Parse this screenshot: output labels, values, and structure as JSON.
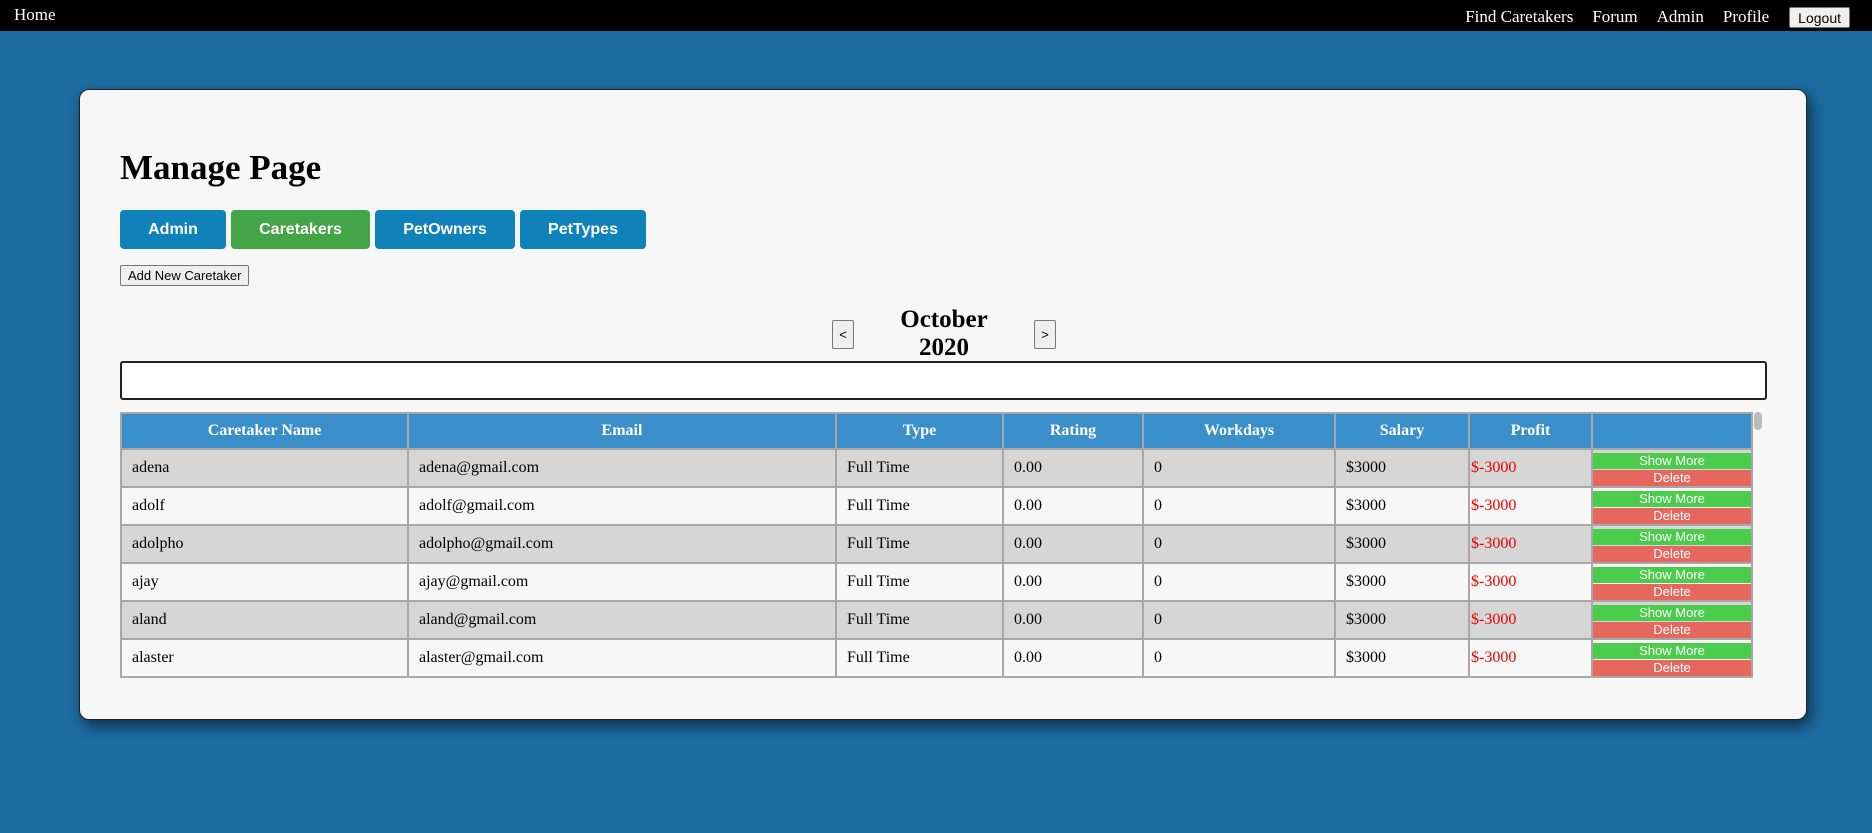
{
  "nav": {
    "home": "Home",
    "links": [
      "Find Caretakers",
      "Forum",
      "Admin",
      "Profile"
    ],
    "logout": "Logout"
  },
  "page": {
    "title": "Manage Page",
    "tabs": [
      "Admin",
      "Caretakers",
      "PetOwners",
      "PetTypes"
    ],
    "active_tab": "Caretakers",
    "add_button": "Add New Caretaker",
    "prev": "<",
    "next": ">",
    "month": "October 2020",
    "search_value": ""
  },
  "table": {
    "headers": [
      "Caretaker Name",
      "Email",
      "Type",
      "Rating",
      "Workdays",
      "Salary",
      "Profit",
      ""
    ],
    "show_more": "Show More",
    "delete": "Delete",
    "rows": [
      [
        "adena",
        "adena@gmail.com",
        "Full Time",
        "0.00",
        "0",
        "$3000",
        "$-3000"
      ],
      [
        "adolf",
        "adolf@gmail.com",
        "Full Time",
        "0.00",
        "0",
        "$3000",
        "$-3000"
      ],
      [
        "adolpho",
        "adolpho@gmail.com",
        "Full Time",
        "0.00",
        "0",
        "$3000",
        "$-3000"
      ],
      [
        "ajay",
        "ajay@gmail.com",
        "Full Time",
        "0.00",
        "0",
        "$3000",
        "$-3000"
      ],
      [
        "aland",
        "aland@gmail.com",
        "Full Time",
        "0.00",
        "0",
        "$3000",
        "$-3000"
      ],
      [
        "alaster",
        "alaster@gmail.com",
        "Full Time",
        "0.00",
        "0",
        "$3000",
        "$-3000"
      ]
    ]
  },
  "colors": {
    "background": "#1d6ba1",
    "tab_blue": "#0f82ba",
    "tab_green": "#44a548",
    "header": "#3a8fca",
    "show_more": "#4ccc4c",
    "delete": "#e5675d",
    "profit_negative": "#ee0000"
  }
}
